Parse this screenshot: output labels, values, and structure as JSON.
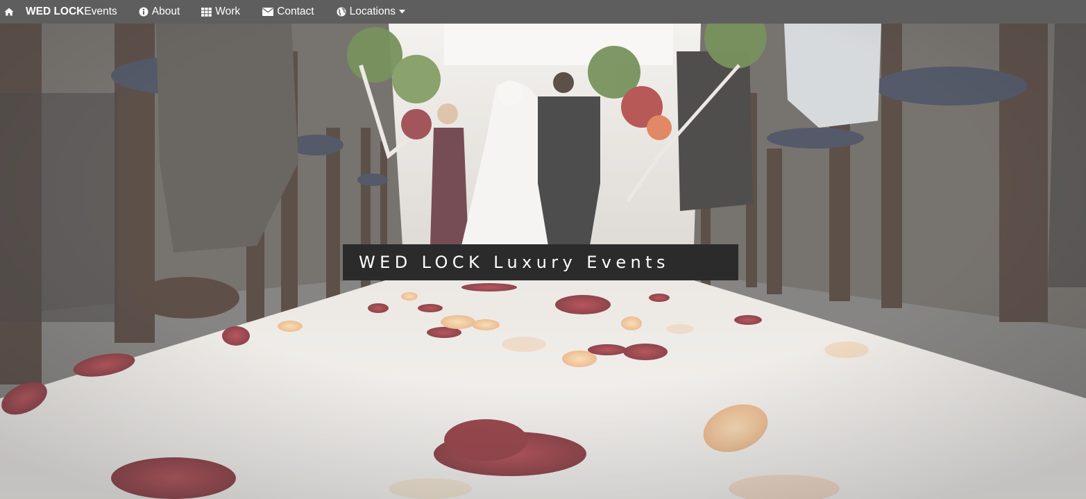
{
  "navbar": {
    "home_icon": "home-icon",
    "brand_bold": "WED LOCK",
    "brand_rest": "Events",
    "items": [
      {
        "label": "About",
        "icon": "info-circle-icon"
      },
      {
        "label": "Work",
        "icon": "grid-icon"
      },
      {
        "label": "Contact",
        "icon": "envelope-icon"
      },
      {
        "label": "Locations",
        "icon": "globe-icon",
        "dropdown": true
      }
    ]
  },
  "hero": {
    "caption": "WED LOCK Luxury Events",
    "image_subject": "wedding ceremony aisle with rose petals"
  },
  "colors": {
    "navbar_bg": "#5e5e5e",
    "caption_bg": "#2b2b2b",
    "text_white": "#ffffff"
  }
}
